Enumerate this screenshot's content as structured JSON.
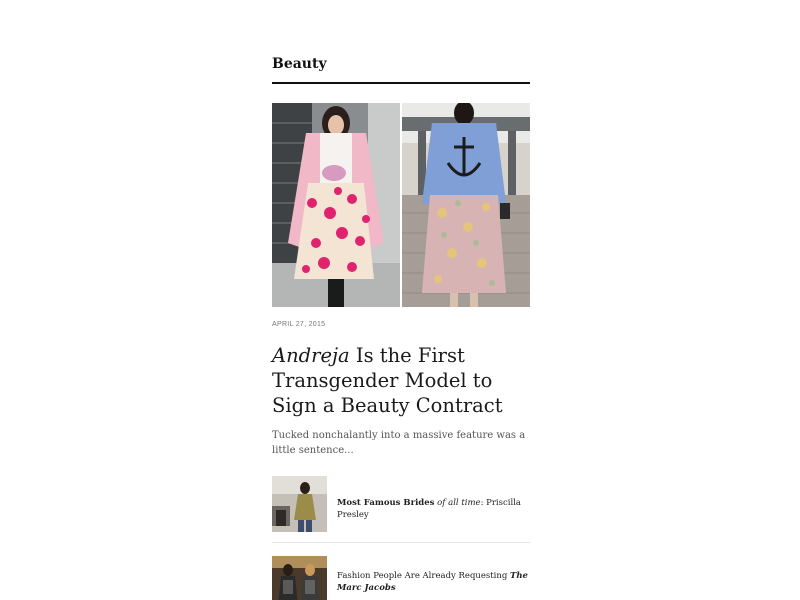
{
  "section": {
    "title": "Beauty"
  },
  "feature": {
    "date": "APRIL 27, 2015",
    "headline_name": "Andreja",
    "headline_rest": " Is the First Transgender Model to Sign a Beauty Contract",
    "excerpt": "Tucked nonchalantly into a massive feature was a little sentence..."
  },
  "teasers": [
    {
      "part1": "Most Famous Brides",
      "part2": " of all time",
      "part3": ": Priscilla Presley"
    },
    {
      "part1": "Fashion People Are Already Requesting ",
      "part2": "The Marc Jacobs"
    }
  ]
}
